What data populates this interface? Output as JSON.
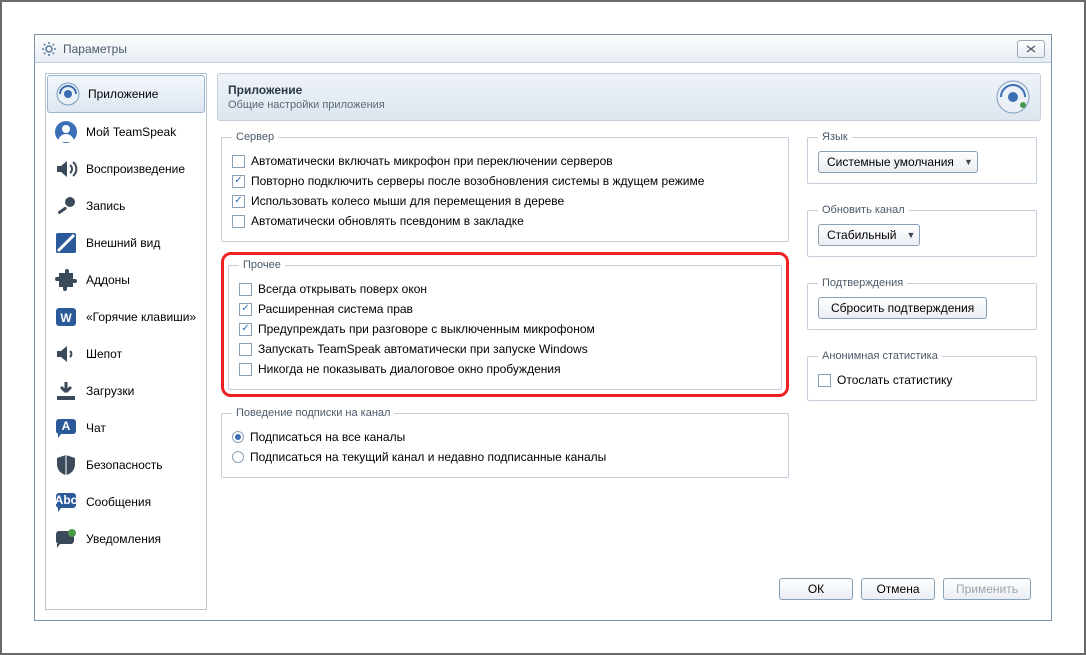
{
  "window": {
    "title": "Параметры"
  },
  "sidebar": {
    "items": [
      {
        "label": "Приложение"
      },
      {
        "label": "Мой TeamSpeak"
      },
      {
        "label": "Воспроизведение"
      },
      {
        "label": "Запись"
      },
      {
        "label": "Внешний вид"
      },
      {
        "label": "Аддоны"
      },
      {
        "label": "«Горячие клавиши»"
      },
      {
        "label": "Шепот"
      },
      {
        "label": "Загрузки"
      },
      {
        "label": "Чат"
      },
      {
        "label": "Безопасность"
      },
      {
        "label": "Сообщения"
      },
      {
        "label": "Уведомления"
      }
    ]
  },
  "header": {
    "title": "Приложение",
    "subtitle": "Общие настройки приложения"
  },
  "server_group": {
    "legend": "Сервер",
    "items": [
      {
        "label": "Автоматически включать микрофон при переключении серверов",
        "checked": false
      },
      {
        "label": "Повторно подключить серверы после возобновления системы в ждущем режиме",
        "checked": true
      },
      {
        "label": "Использовать колесо мыши для перемещения в дереве",
        "checked": true
      },
      {
        "label": "Автоматически обновлять псевдоним в закладке",
        "checked": false
      }
    ]
  },
  "misc_group": {
    "legend": "Прочее",
    "items": [
      {
        "label": "Всегда открывать поверх окон",
        "checked": false
      },
      {
        "label": "Расширенная система прав",
        "checked": true
      },
      {
        "label": "Предупреждать при разговоре с выключенным микрофоном",
        "checked": true
      },
      {
        "label": "Запускать TeamSpeak автоматически при запуске Windows",
        "checked": false
      },
      {
        "label": "Никогда не показывать диалоговое окно пробуждения",
        "checked": false
      }
    ]
  },
  "subscribe_group": {
    "legend": "Поведение подписки на канал",
    "options": [
      {
        "label": "Подписаться на все каналы",
        "selected": true
      },
      {
        "label": "Подписаться на текущий канал и недавно подписанные каналы",
        "selected": false
      }
    ]
  },
  "language_group": {
    "legend": "Язык",
    "value": "Системные умолчания"
  },
  "update_group": {
    "legend": "Обновить канал",
    "value": "Стабильный"
  },
  "confirm_group": {
    "legend": "Подтверждения",
    "button": "Сбросить подтверждения"
  },
  "anon_group": {
    "legend": "Анонимная статистика",
    "checkbox": {
      "label": "Отослать статистику",
      "checked": false
    }
  },
  "footer": {
    "ok": "ОК",
    "cancel": "Отмена",
    "apply": "Применить"
  }
}
